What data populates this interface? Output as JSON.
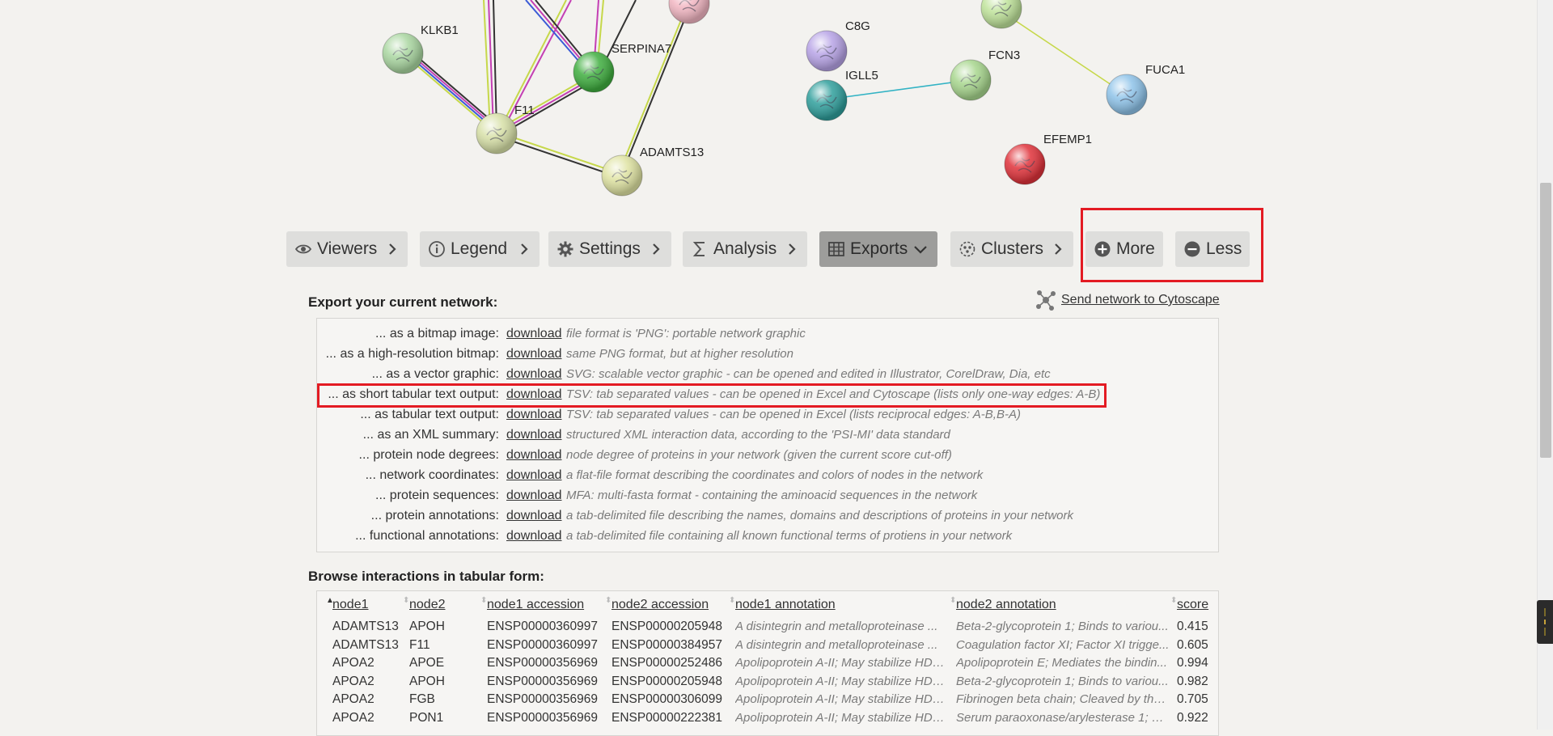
{
  "network": {
    "nodes": [
      {
        "id": "KLKB1",
        "label": "KLKB1",
        "color": "#a9d6a0"
      },
      {
        "id": "SERPINA7",
        "label": "SERPINA7",
        "color": "#3fae3f"
      },
      {
        "id": "F11",
        "label": "F11",
        "color": "#d7e0a7"
      },
      {
        "id": "ADAMTS13",
        "label": "ADAMTS13",
        "color": "#dfe3a2"
      },
      {
        "id": "C8G",
        "label": "C8G",
        "color": "#b7a3e6"
      },
      {
        "id": "IGLL5",
        "label": "IGLL5",
        "color": "#2f9f9c"
      },
      {
        "id": "FCN3",
        "label": "FCN3",
        "color": "#a7d68d"
      },
      {
        "id": "FUCA1",
        "label": "FUCA1",
        "color": "#8ec3e9"
      },
      {
        "id": "EFEMP1",
        "label": "EFEMP1",
        "color": "#e0323a"
      },
      {
        "id": "PINK_TOP",
        "label": "",
        "color": "#f2b6c2"
      },
      {
        "id": "GREEN_TOP",
        "label": "",
        "color": "#bfe39a"
      }
    ],
    "edge_colors": [
      "#c6d84a",
      "#3b5bd6",
      "#c43fb4",
      "#333333",
      "#32b3c4"
    ]
  },
  "toolbar": {
    "items": [
      {
        "label": "Viewers",
        "icon": "eye-icon",
        "state": "collapsed"
      },
      {
        "label": "Legend",
        "icon": "info-icon",
        "state": "collapsed"
      },
      {
        "label": "Settings",
        "icon": "gear-icon",
        "state": "collapsed"
      },
      {
        "label": "Analysis",
        "icon": "sigma-icon",
        "state": "collapsed"
      },
      {
        "label": "Exports",
        "icon": "table-icon",
        "state": "expanded"
      },
      {
        "label": "Clusters",
        "icon": "clusters-icon",
        "state": "collapsed"
      }
    ],
    "more_label": "More",
    "less_label": "Less"
  },
  "exports": {
    "title": "Export your current network:",
    "cytoscape_link": "Send network to Cytoscape",
    "download_label": "download",
    "rows": [
      {
        "label": "... as a bitmap image:",
        "desc": "file format is 'PNG': portable network graphic"
      },
      {
        "label": "... as a high-resolution bitmap:",
        "desc": "same PNG format, but at higher resolution"
      },
      {
        "label": "... as a vector graphic:",
        "desc": "SVG: scalable vector graphic - can be opened and edited in Illustrator, CorelDraw, Dia, etc"
      },
      {
        "label": "... as short tabular text output:",
        "desc": "TSV: tab separated values - can be opened in Excel and Cytoscape (lists only one-way edges: A-B)"
      },
      {
        "label": "... as tabular text output:",
        "desc": "TSV: tab separated values - can be opened in Excel (lists reciprocal edges: A-B,B-A)"
      },
      {
        "label": "... as an XML summary:",
        "desc": "structured XML interaction data, according to the 'PSI-MI' data standard"
      },
      {
        "label": "... protein node degrees:",
        "desc": "node degree of proteins in your network (given the current score cut-off)"
      },
      {
        "label": "... network coordinates:",
        "desc": "a flat-file format describing the coordinates and colors of nodes in the network"
      },
      {
        "label": "... protein sequences:",
        "desc": "MFA: multi-fasta format - containing the aminoacid sequences in the network"
      },
      {
        "label": "... protein annotations:",
        "desc": "a tab-delimited file describing the names, domains and descriptions of proteins in your network"
      },
      {
        "label": "... functional annotations:",
        "desc": "a tab-delimited file containing all known functional terms of protiens in your network"
      }
    ]
  },
  "interactions": {
    "title": "Browse interactions in tabular form:",
    "columns": [
      "node1",
      "node2",
      "node1 accession",
      "node2 accession",
      "node1 annotation",
      "node2 annotation",
      "score"
    ],
    "rows": [
      [
        "ADAMTS13",
        "APOH",
        "ENSP00000360997",
        "ENSP00000205948",
        "A disintegrin and metalloproteinase ...",
        "Beta-2-glycoprotein 1; Binds to variou...",
        "0.415"
      ],
      [
        "ADAMTS13",
        "F11",
        "ENSP00000360997",
        "ENSP00000384957",
        "A disintegrin and metalloproteinase ...",
        "Coagulation factor XI; Factor XI trigge...",
        "0.605"
      ],
      [
        "APOA2",
        "APOE",
        "ENSP00000356969",
        "ENSP00000252486",
        "Apolipoprotein A-II; May stabilize HDL...",
        "Apolipoprotein E; Mediates the bindin...",
        "0.994"
      ],
      [
        "APOA2",
        "APOH",
        "ENSP00000356969",
        "ENSP00000205948",
        "Apolipoprotein A-II; May stabilize HDL...",
        "Beta-2-glycoprotein 1; Binds to variou...",
        "0.982"
      ],
      [
        "APOA2",
        "FGB",
        "ENSP00000356969",
        "ENSP00000306099",
        "Apolipoprotein A-II; May stabilize HDL...",
        "Fibrinogen beta chain; Cleaved by the...",
        "0.705"
      ],
      [
        "APOA2",
        "PON1",
        "ENSP00000356969",
        "ENSP00000222381",
        "Apolipoprotein A-II; May stabilize HDL...",
        "Serum paraoxonase/arylesterase 1; H...",
        "0.922"
      ]
    ]
  },
  "highlight_color": "#e31b23"
}
